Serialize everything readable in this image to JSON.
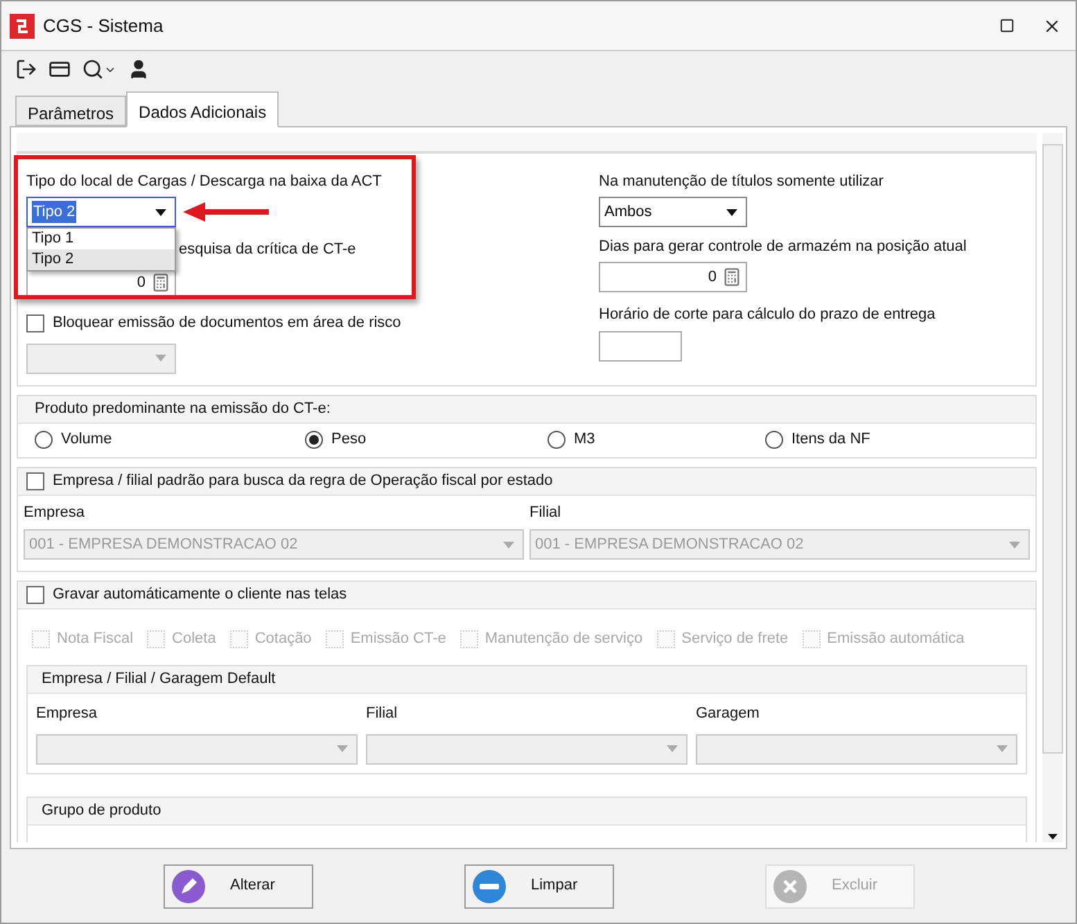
{
  "window": {
    "title": "CGS - Sistema"
  },
  "tabs": [
    {
      "label": "Parâmetros",
      "selected": false
    },
    {
      "label": "Dados Adicionais",
      "selected": true
    }
  ],
  "tipo_local": {
    "label": "Tipo do local de Cargas / Descarga na baixa da ACT",
    "value": "Tipo 2",
    "expanded": true,
    "options": [
      {
        "label": "Tipo 1",
        "selected": false
      },
      {
        "label": "Tipo 2",
        "selected": true
      }
    ]
  },
  "pesquisa_critica": {
    "label": "esquisa da crítica de CT-e",
    "value": "0"
  },
  "bloquear": {
    "label": "Bloquear emissão de documentos em área de risco",
    "checked": false,
    "select_disabled": true
  },
  "manutencao_titulos": {
    "label": "Na manutenção de títulos somente utilizar",
    "value": "Ambos"
  },
  "dias_armazem": {
    "label": "Dias para gerar controle de armazém na posição atual",
    "value": "0"
  },
  "horario_corte": {
    "label": "Horário de corte para cálculo do prazo de entrega"
  },
  "produto_predominante": {
    "title": "Produto predominante na emissão do CT-e:",
    "options": [
      {
        "label": "Volume",
        "selected": false
      },
      {
        "label": "Peso",
        "selected": true
      },
      {
        "label": "M3",
        "selected": false
      },
      {
        "label": "Itens da NF",
        "selected": false
      }
    ]
  },
  "empresa_filial_padrao": {
    "label": "Empresa / filial padrão para busca da regra de Operação fiscal por estado",
    "checked": false,
    "fields": [
      {
        "label": "Empresa",
        "value": "001 - EMPRESA DEMONSTRACAO 02",
        "disabled": true
      },
      {
        "label": "Filial",
        "value": "001 - EMPRESA DEMONSTRACAO 02",
        "disabled": true
      }
    ]
  },
  "gravar_cliente": {
    "label": "Gravar automáticamente o cliente nas telas",
    "checked": false,
    "screens": [
      {
        "label": "Nota Fiscal",
        "checked": false,
        "disabled": true
      },
      {
        "label": "Coleta",
        "checked": false,
        "disabled": true
      },
      {
        "label": "Cotação",
        "checked": false,
        "disabled": true
      },
      {
        "label": "Emissão CT-e",
        "checked": false,
        "disabled": true
      },
      {
        "label": "Manutenção de serviço",
        "checked": false,
        "disabled": true
      },
      {
        "label": "Serviço de frete",
        "checked": false,
        "disabled": true
      },
      {
        "label": "Emissão automática",
        "checked": false,
        "disabled": true
      }
    ],
    "default_group": {
      "title": "Empresa / Filial / Garagem Default",
      "fields": [
        {
          "label": "Empresa",
          "disabled": true
        },
        {
          "label": "Filial",
          "disabled": true
        },
        {
          "label": "Garagem",
          "disabled": true
        }
      ]
    }
  },
  "grupo_produto": {
    "title": "Grupo de produto"
  },
  "buttons": [
    {
      "label": "Alterar",
      "kind": "edit",
      "disabled": false
    },
    {
      "label": "Limpar",
      "kind": "clear",
      "disabled": false
    },
    {
      "label": "Excluir",
      "kind": "delete",
      "disabled": true
    }
  ]
}
